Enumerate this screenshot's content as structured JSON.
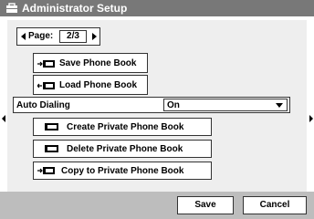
{
  "window": {
    "title": "Administrator Setup",
    "title_icon": "toolbox-icon"
  },
  "pager": {
    "label": "Page:",
    "value": "2/3"
  },
  "menu": {
    "save_phone_book": "Save Phone Book",
    "load_phone_book": "Load Phone Book",
    "auto_dialing": {
      "label": "Auto Dialing",
      "value": "On"
    },
    "create_private": "Create Private Phone Book",
    "delete_private": "Delete Private Phone Book",
    "copy_private": "Copy to Private Phone Book"
  },
  "footer": {
    "save_label": "Save",
    "cancel_label": "Cancel"
  },
  "colors": {
    "titlebar": "#787878",
    "panel": "#eeeeee",
    "footer": "#bdbdbd"
  }
}
